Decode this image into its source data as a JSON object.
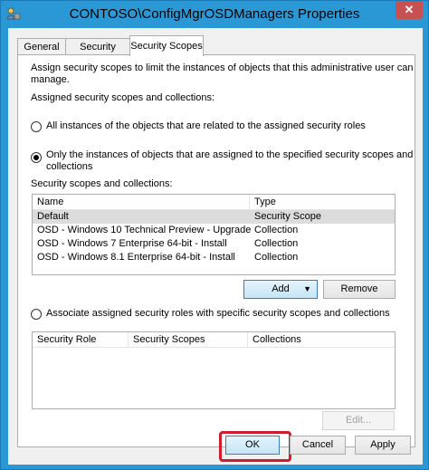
{
  "window": {
    "title": "CONTOSO\\ConfigMgrOSDManagers Properties",
    "close_label": "✕"
  },
  "tabs": [
    {
      "label": "General"
    },
    {
      "label": "Security Roles"
    },
    {
      "label": "Security Scopes"
    }
  ],
  "panel": {
    "intro_line1": "Assign security scopes to limit the instances of objects that  this administrative user can",
    "intro_line2": "manage.",
    "assigned_heading": "Assigned security scopes and collections:",
    "radio_all": "All instances of the objects that are related to the assigned security roles",
    "radio_only_line1": "Only the instances of objects  that are assigned to the specified security scopes and",
    "radio_only_line2": "collections",
    "list_label": "Security scopes and collections:",
    "scopes_table": {
      "columns": [
        "Name",
        "Type"
      ],
      "rows": [
        {
          "name": "Default",
          "type": "Security Scope"
        },
        {
          "name": "OSD - Windows 10 Technical Preview - Upgrade",
          "type": "Collection"
        },
        {
          "name": "OSD - Windows 7 Enterprise 64-bit - Install",
          "type": "Collection"
        },
        {
          "name": "OSD - Windows 8.1 Enterprise 64-bit - Install",
          "type": "Collection"
        }
      ]
    },
    "add_label": "Add",
    "remove_label": "Remove",
    "radio_associate": "Associate assigned security roles with specific security scopes and collections",
    "roles_table": {
      "columns": [
        "Security Role",
        "Security Scopes",
        "Collections"
      ]
    },
    "edit_label": "Edit..."
  },
  "footer": {
    "ok_label": "OK",
    "cancel_label": "Cancel",
    "apply_label": "Apply"
  },
  "colors": {
    "titlebar": "#2b98d6",
    "highlight_box": "#d01c2c"
  }
}
